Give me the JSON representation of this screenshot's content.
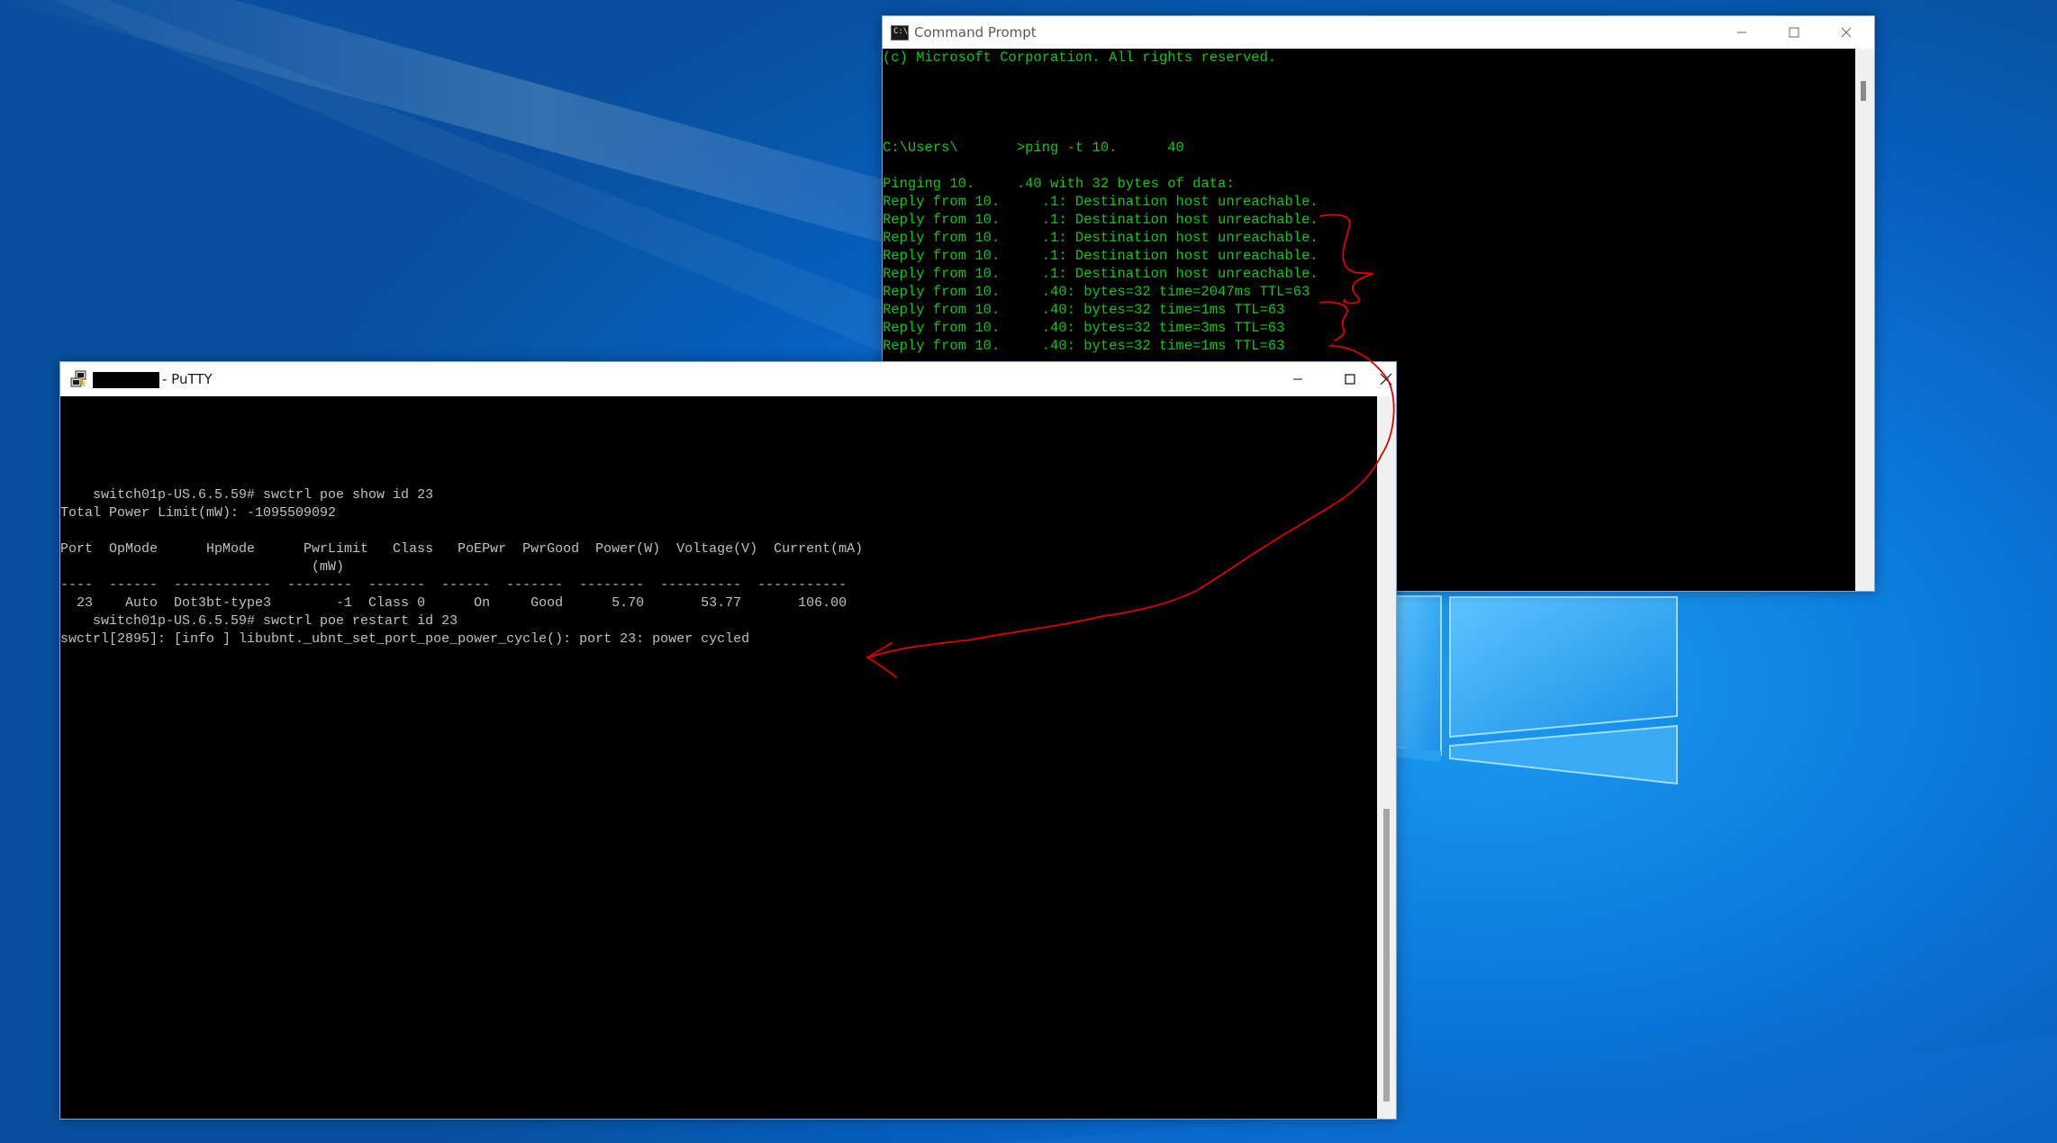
{
  "command_prompt": {
    "title": "Command Prompt",
    "lines": [
      "(c) Microsoft Corporation. All rights reserved.",
      "",
      "",
      "",
      "",
      "C:\\Users\\       >ping -t 10.      40",
      "",
      "Pinging 10.     .40 with 32 bytes of data:",
      "Reply from 10.     .1: Destination host unreachable.",
      "Reply from 10.     .1: Destination host unreachable.",
      "Reply from 10.     .1: Destination host unreachable.",
      "Reply from 10.     .1: Destination host unreachable.",
      "Reply from 10.     .1: Destination host unreachable.",
      "Reply from 10.     .40: bytes=32 time=2047ms TTL=63",
      "Reply from 10.     .40: bytes=32 time=1ms TTL=63",
      "Reply from 10.     .40: bytes=32 time=3ms TTL=63",
      "Reply from 10.     .40: bytes=32 time=1ms TTL=63"
    ],
    "text_color": "#13c616"
  },
  "putty": {
    "title": "- PuTTY",
    "lines": [
      "",
      "",
      "",
      "",
      "",
      "    switch01p-US.6.5.59# swctrl poe show id 23",
      "Total Power Limit(mW): -1095509092",
      "",
      "Port  OpMode      HpMode      PwrLimit   Class   PoEPwr  PwrGood  Power(W)  Voltage(V)  Current(mA)",
      "                               (mW)",
      "----  ------  ------------  --------  -------  ------  -------  --------  ----------  -----------",
      "  23    Auto  Dot3bt-type3        -1  Class 0      On     Good      5.70       53.77       106.00",
      "    switch01p-US.6.5.59# swctrl poe restart id 23",
      "swctrl[2895]: [info ] libubnt._ubnt_set_port_poe_power_cycle(): port 23: power cycled"
    ],
    "text_color": "#c0c0c0"
  },
  "window_controls": {
    "minimize": "—",
    "maximize": "☐",
    "close": "✕"
  },
  "annotation_color": "#e00000"
}
